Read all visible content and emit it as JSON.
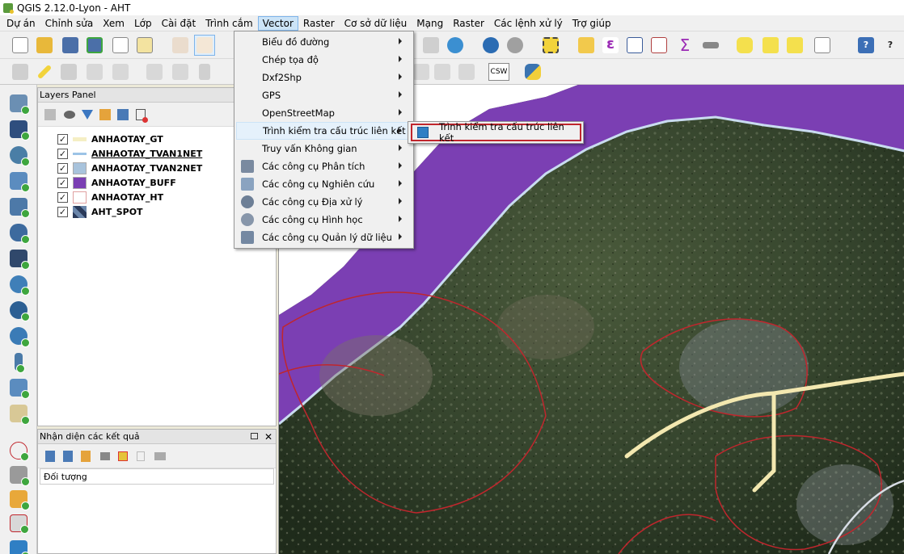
{
  "window": {
    "title": "QGIS 2.12.0-Lyon - AHT"
  },
  "menubar": {
    "items": [
      "Dự án",
      "Chỉnh sửa",
      "Xem",
      "Lớp",
      "Cài đặt",
      "Trình cắm",
      "Vector",
      "Raster",
      "Cơ sở dữ liệu",
      "Mạng",
      "Raster",
      "Các lệnh xử lý",
      "Trợ giúp"
    ],
    "active_index": 6
  },
  "toolbar2": {
    "csw_label": "CSW"
  },
  "layers_panel": {
    "title": "Layers Panel",
    "layers": [
      {
        "name": "ANHAOTAY_GT",
        "checked": "✓",
        "color": "#f5efc4"
      },
      {
        "name": "ANHAOTAY_TVAN1NET",
        "checked": "✓",
        "color": "#9cc3e6"
      },
      {
        "name": "ANHAOTAY_TVAN2NET",
        "checked": "✓",
        "color": "#a8c3dc"
      },
      {
        "name": "ANHAOTAY_BUFF",
        "checked": "✓",
        "color": "#7b3fb3"
      },
      {
        "name": "ANHAOTAY_HT",
        "checked": "✓",
        "color": "#ffffff"
      },
      {
        "name": "AHT_SPOT",
        "checked": "✓",
        "color": "#3a4b6b"
      }
    ]
  },
  "results_panel": {
    "title": "Nhận diện các kết quả",
    "column_header": "Đối tượng"
  },
  "vector_menu": {
    "items": [
      {
        "label": "Biểu đồ đường",
        "icon": ""
      },
      {
        "label": "Chép tọa độ",
        "icon": ""
      },
      {
        "label": "Dxf2Shp",
        "icon": ""
      },
      {
        "label": "GPS",
        "icon": ""
      },
      {
        "label": "OpenStreetMap",
        "icon": ""
      },
      {
        "label": "Trình kiểm tra cấu trúc liên kết",
        "icon": ""
      },
      {
        "label": "Truy vấn Không gian",
        "icon": ""
      },
      {
        "label": "Các công cụ Phân tích",
        "icon": "analysis-icon"
      },
      {
        "label": "Các công cụ Nghiên cứu",
        "icon": "research-icon"
      },
      {
        "label": "Các công cụ Địa xử lý",
        "icon": "geoprocessing-icon"
      },
      {
        "label": "Các công cụ Hình học",
        "icon": "geometry-icon"
      },
      {
        "label": "Các công cụ Quản lý dữ liệu",
        "icon": "data-management-icon"
      }
    ],
    "highlighted_index": 5
  },
  "submenu": {
    "label": "Trình kiểm tra cấu trúc liên kết",
    "icon": "topology-checker-icon"
  },
  "colors": {
    "buffer_purple": "#7b3fb3",
    "road": "#f3e8b0",
    "boundary_red": "#c0262d",
    "menu_highlight": "#e5f1fb"
  }
}
